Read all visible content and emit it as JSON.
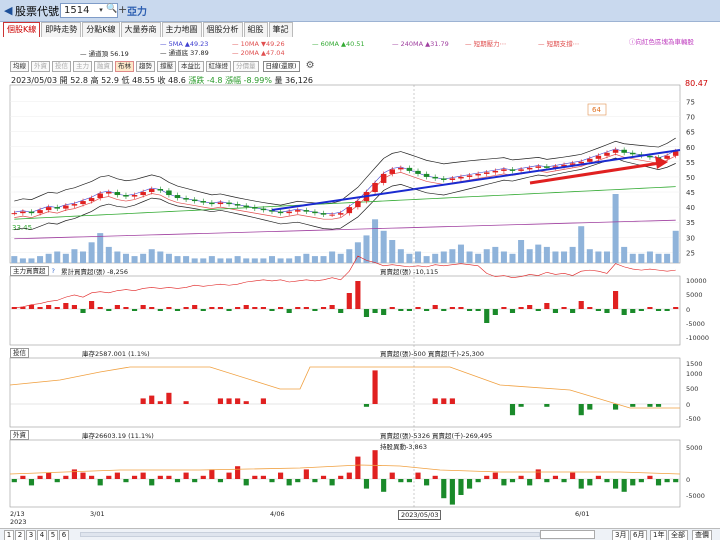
{
  "topbar": {
    "app_title": "股票代號",
    "stock_code": "1514",
    "stock_name": "亞力",
    "dropdown": "▾",
    "search_icon": "search-icon",
    "add_icon": "plus-icon"
  },
  "tabs": [
    "個股K線",
    "即時走勢",
    "分點K線",
    "大量券商",
    "主力地圖",
    "個股分析",
    "組股",
    "筆記"
  ],
  "legend": {
    "ma5": "5MA ▲49.23",
    "ma10": "10MA ▼49.26",
    "ma60": "60MA ▲40.51",
    "ma240": "240MA ▲31.79",
    "short_force": "短期壓力⋯",
    "short_support": "短期支撐⋯",
    "upper": "通道頂 56.19",
    "lower": "通道底 37.89",
    "ma20": "20MA ▲47.04",
    "note": "向紅色區塊為車輛股",
    "colors": {
      "ma5": "#4040d0",
      "ma10": "#e05050",
      "ma60": "#33aa33",
      "ma240": "#a040a0",
      "ma20": "#e05050",
      "channel": "#222222"
    }
  },
  "toolbar": {
    "buttons": [
      "均線",
      "外資",
      "投信",
      "主力",
      "融資",
      "布林",
      "趨勢",
      "撐壓",
      "本益比",
      "紅綠燈",
      "分價量"
    ],
    "period": "日線(還原)",
    "gear_icon": "gear-icon"
  },
  "info": {
    "date": "2023/05/03",
    "open": "開 52.8",
    "high": "高 52.9",
    "low": "低 48.55",
    "close": "收 48.6",
    "chg": "漲跌 -4.8",
    "pct": "漲幅 -8.99%",
    "vol": "量 36,126"
  },
  "price_axis": {
    "last": "80.47",
    "ticks": [
      "75",
      "70",
      "65",
      "60",
      "55",
      "50",
      "45",
      "40",
      "35",
      "30",
      "25"
    ],
    "label_left": "33.45",
    "annotation": "64"
  },
  "panel1": {
    "select": "主力買賣超",
    "help": "?",
    "t1": "累計買賣超(張) -8,256",
    "t2": "買賣超(張) -10,115",
    "ticks": [
      "10000",
      "5000",
      "0",
      "-5000",
      "-10000"
    ]
  },
  "panel2": {
    "select": "投信",
    "t1": "庫存2587.001 (1.1%)",
    "t2": "買賣超(張)-500 買賣超(千)-25,300",
    "ticks": [
      "1500",
      "1000",
      "500",
      "0",
      "-500"
    ]
  },
  "panel3": {
    "select": "外資",
    "t1": "庫存26603.19 (11.1%)",
    "t2": "買賣超(張)-5326 買賣超(千)-269,495",
    "t3": "持股異動-3,863",
    "ticks": [
      "5000",
      "0",
      "-5000"
    ]
  },
  "xaxis": {
    "labels": [
      "2/13",
      "3/01",
      "4/06",
      "2023/05/03",
      "6/01"
    ],
    "year": "2023"
  },
  "bottom": {
    "pages": [
      "1",
      "2",
      "3",
      "4",
      "5",
      "6"
    ],
    "ranges": [
      "3月",
      "6月",
      "1年",
      "全部",
      "查價"
    ]
  }
}
